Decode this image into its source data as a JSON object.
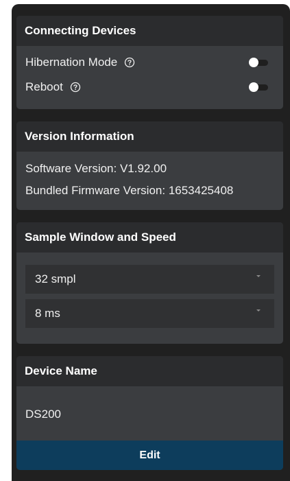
{
  "connecting_devices": {
    "title": "Connecting Devices",
    "hibernation_label": "Hibernation Mode",
    "hibernation_enabled": false,
    "reboot_label": "Reboot",
    "reboot_enabled": false
  },
  "version_information": {
    "title": "Version Information",
    "software_version": "Software Version: V1.92.00",
    "firmware_version": "Bundled Firmware Version: 1653425408"
  },
  "sample_window": {
    "title": "Sample Window and Speed",
    "window_value": "32 smpl",
    "speed_value": "8 ms"
  },
  "device_name": {
    "title": "Device Name",
    "value": "DS200",
    "edit_label": "Edit"
  },
  "colors": {
    "panel_background": "#202020",
    "card_background": "#3b3d40",
    "card_header": "#2b2c2e",
    "button_accent": "#0d3d5c",
    "text": "#f0f0f0"
  }
}
